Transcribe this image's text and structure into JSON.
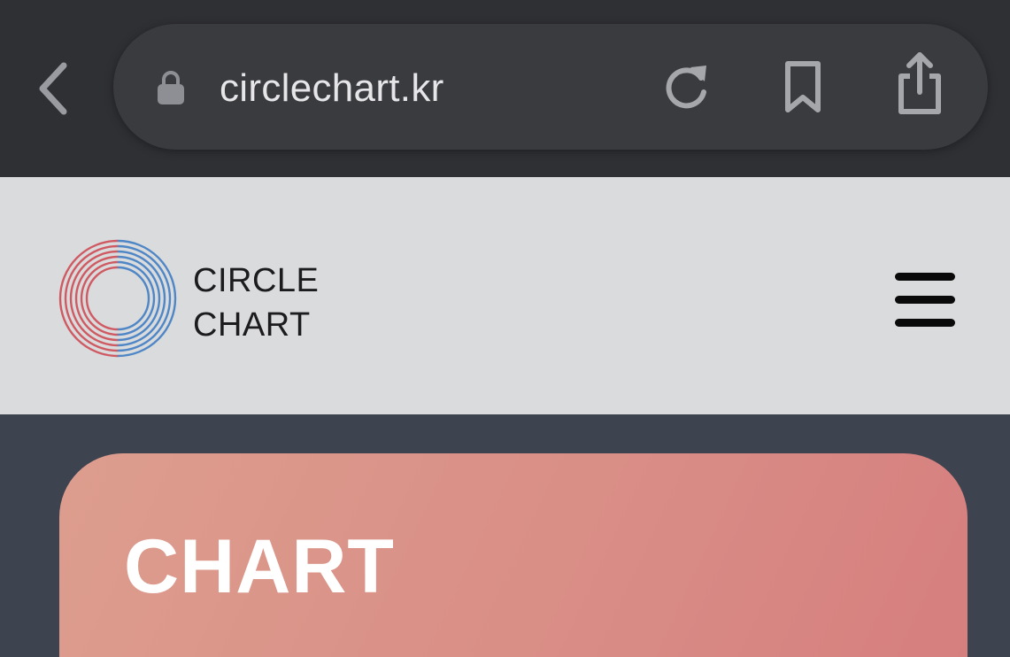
{
  "browser": {
    "url": "circlechart.kr",
    "icons": {
      "back": "chevron-left-icon",
      "lock": "lock-icon",
      "reload": "reload-icon",
      "bookmark": "bookmark-icon",
      "share": "share-icon"
    }
  },
  "header": {
    "logo": {
      "line1": "CIRCLE",
      "line2": "CHART"
    },
    "menu_icon": "hamburger-menu-icon"
  },
  "hero": {
    "title": "CHART"
  },
  "colors": {
    "browser_bar": "#2f3034",
    "url_pill": "#3a3b3f",
    "header_bg": "#dadbdd",
    "page_bg": "#3e4350",
    "logo_red": "#cf5a62",
    "logo_blue": "#4f86c6",
    "hero_gradient_start": "#dd9e8e",
    "hero_gradient_end": "#d67f7f"
  }
}
